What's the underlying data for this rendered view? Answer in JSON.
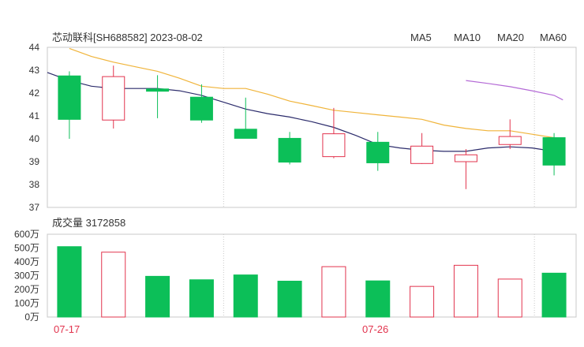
{
  "header": {
    "title": "芯动联科[SH688582] 2023-08-02",
    "legend": [
      {
        "label": "MA5",
        "color": "#2b2b6b"
      },
      {
        "label": "MA10",
        "color": "#f0b43a"
      },
      {
        "label": "MA20",
        "color": "#b46ad6"
      },
      {
        "label": "MA60",
        "color": "#f0a0d0"
      }
    ]
  },
  "volume_header": {
    "label": "成交量 3172858"
  },
  "colors": {
    "up": "#e2344e",
    "down": "#0cbf58",
    "grid": "#c8c8c8"
  },
  "chart_data": [
    {
      "type": "candlestick",
      "title": "芯动联科[SH688582] 2023-08-02",
      "ylim": [
        37,
        44
      ],
      "yticks": [
        "44",
        "43",
        "42",
        "41",
        "40",
        "39",
        "38",
        "37"
      ],
      "xticks": [
        "07-17",
        "07-26"
      ],
      "candles": [
        {
          "open": 42.75,
          "close": 40.85,
          "high": 42.95,
          "low": 40.0
        },
        {
          "open": 40.82,
          "close": 42.72,
          "high": 43.2,
          "low": 40.45
        },
        {
          "open": 42.18,
          "close": 42.08,
          "high": 42.78,
          "low": 40.9
        },
        {
          "open": 41.82,
          "close": 40.82,
          "high": 42.38,
          "low": 40.7
        },
        {
          "open": 40.42,
          "close": 40.02,
          "high": 41.8,
          "low": 40.02
        },
        {
          "open": 40.02,
          "close": 38.98,
          "high": 40.3,
          "low": 38.88
        },
        {
          "open": 39.22,
          "close": 40.22,
          "high": 41.35,
          "low": 39.15
        },
        {
          "open": 39.85,
          "close": 38.95,
          "high": 40.3,
          "low": 38.6
        },
        {
          "open": 38.92,
          "close": 39.68,
          "high": 40.25,
          "low": 38.9
        },
        {
          "open": 39.0,
          "close": 39.3,
          "high": 39.55,
          "low": 37.8
        },
        {
          "open": 39.75,
          "close": 40.1,
          "high": 40.85,
          "low": 39.55
        },
        {
          "open": 40.05,
          "close": 38.85,
          "high": 40.25,
          "low": 38.4
        }
      ],
      "series": [
        {
          "name": "MA5",
          "color": "#2b2b6b",
          "x": [
            -0.5,
            0,
            0.5,
            1,
            1.5,
            2,
            2.5,
            3,
            3.5,
            4,
            4.5,
            5,
            5.5,
            6,
            6.5,
            7,
            7.5,
            8,
            8.5,
            9,
            9.5,
            10,
            10.5,
            11
          ],
          "values": [
            42.9,
            42.55,
            42.3,
            42.2,
            42.2,
            42.2,
            42.1,
            41.9,
            41.6,
            41.3,
            41.1,
            40.95,
            40.75,
            40.5,
            40.15,
            39.75,
            39.6,
            39.5,
            39.45,
            39.45,
            39.6,
            39.65,
            39.6,
            39.45
          ]
        },
        {
          "name": "MA10",
          "color": "#f0b43a",
          "x": [
            0,
            0.5,
            1,
            1.5,
            2,
            2.5,
            3,
            3.5,
            4,
            4.5,
            5,
            5.5,
            6,
            6.5,
            7,
            7.5,
            8,
            8.5,
            9,
            9.5,
            10,
            10.5,
            11
          ],
          "values": [
            43.95,
            43.6,
            43.35,
            43.15,
            42.95,
            42.65,
            42.3,
            42.2,
            42.2,
            41.95,
            41.65,
            41.45,
            41.25,
            41.15,
            41.05,
            40.95,
            40.85,
            40.6,
            40.45,
            40.35,
            40.35,
            40.2,
            40.05
          ]
        },
        {
          "name": "MA20",
          "color": "#b46ad6",
          "x": [
            9,
            9.5,
            10,
            10.5,
            11,
            11.2
          ],
          "values": [
            42.55,
            42.42,
            42.28,
            42.1,
            41.9,
            41.7
          ]
        },
        {
          "name": "MA60",
          "color": "#f0a0d0",
          "x": [],
          "values": []
        }
      ]
    },
    {
      "type": "bar",
      "title": "成交量 3172858",
      "ylim": [
        0,
        600
      ],
      "yticks": [
        "600万",
        "500万",
        "400万",
        "300万",
        "200万",
        "100万",
        "0万"
      ],
      "values": [
        510,
        470,
        295,
        270,
        305,
        260,
        365,
        262,
        222,
        375,
        275,
        318
      ],
      "direction": [
        "down",
        "up",
        "down",
        "down",
        "down",
        "down",
        "up",
        "down",
        "up",
        "up",
        "up",
        "down"
      ]
    }
  ]
}
